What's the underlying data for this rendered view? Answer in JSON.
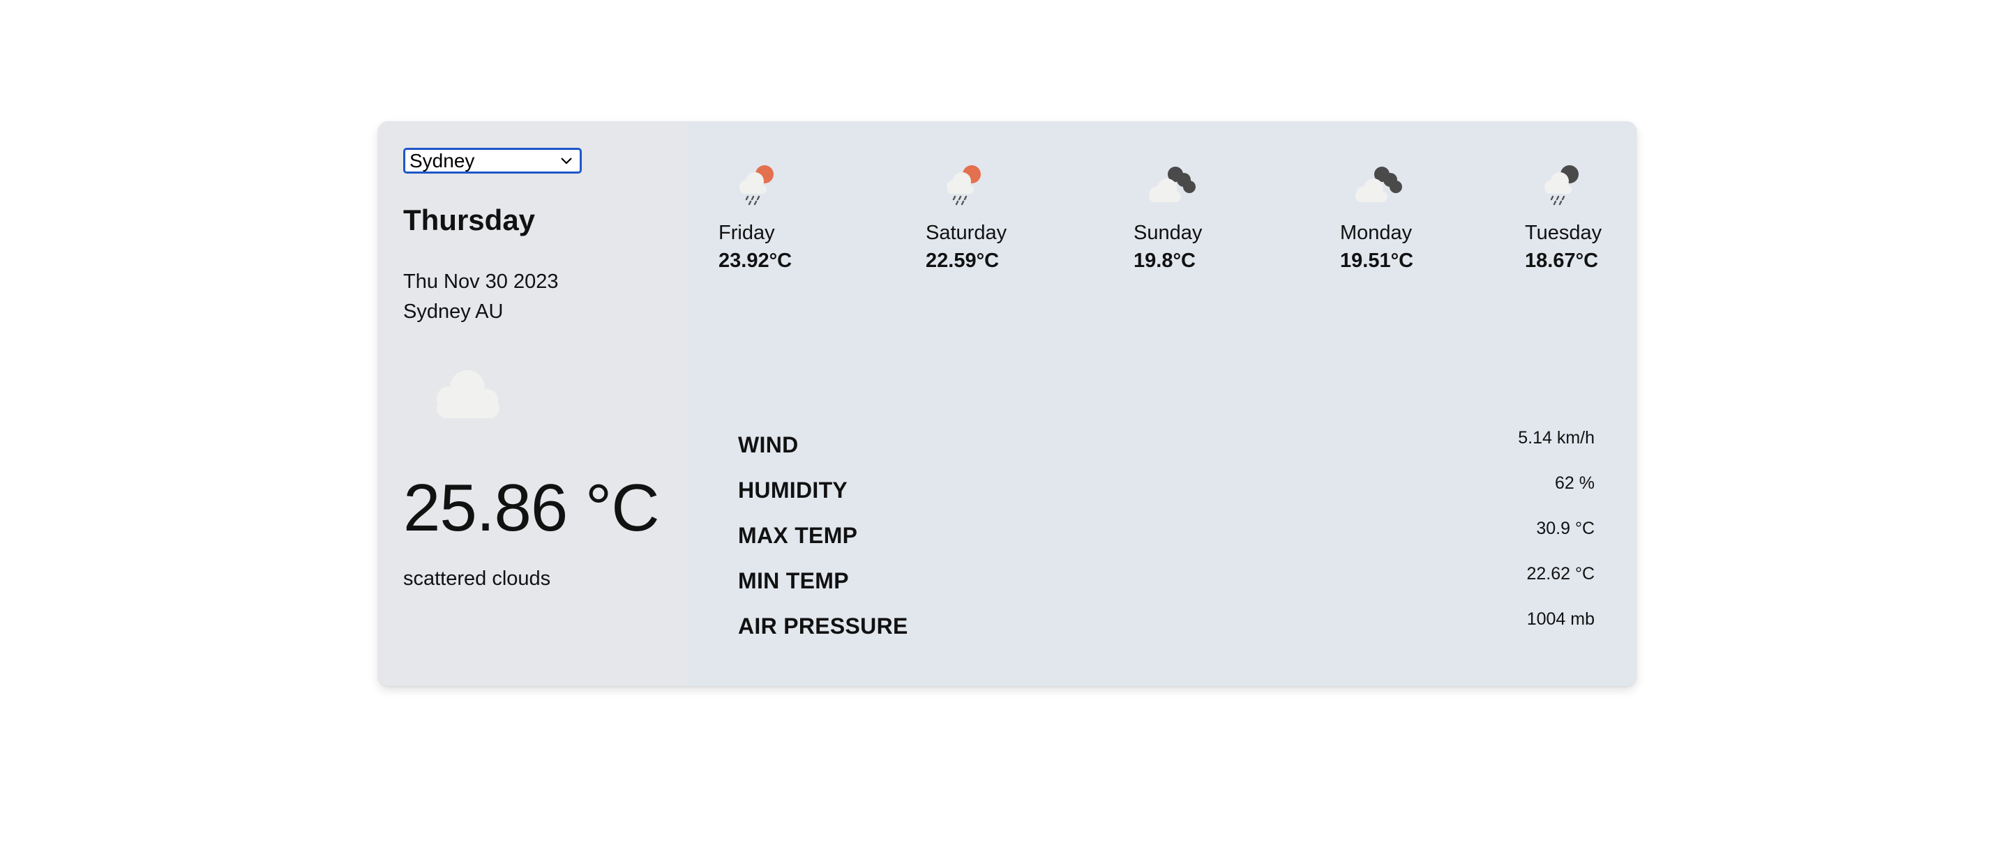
{
  "city_select": {
    "selected": "Sydney"
  },
  "current": {
    "day": "Thursday",
    "date": "Thu Nov 30 2023",
    "location": "Sydney AU",
    "temperature": "25.86 °C",
    "description": "scattered clouds",
    "icon": "cloud-icon"
  },
  "forecast": [
    {
      "day": "Friday",
      "temp": "23.92°C",
      "icon": "light-rain-sun-icon"
    },
    {
      "day": "Saturday",
      "temp": "22.59°C",
      "icon": "light-rain-sun-icon"
    },
    {
      "day": "Sunday",
      "temp": "19.8°C",
      "icon": "broken-clouds-icon"
    },
    {
      "day": "Monday",
      "temp": "19.51°C",
      "icon": "broken-clouds-icon"
    },
    {
      "day": "Tuesday",
      "temp": "18.67°C",
      "icon": "light-rain-dark-cloud-icon"
    }
  ],
  "details": [
    {
      "label": "WIND",
      "value": "5.14 km/h"
    },
    {
      "label": "HUMIDITY",
      "value": "62 %"
    },
    {
      "label": "MAX TEMP",
      "value": "30.9 °C"
    },
    {
      "label": "MIN TEMP",
      "value": "22.62 °C"
    },
    {
      "label": "AIR PRESSURE",
      "value": "1004 mb"
    }
  ],
  "colors": {
    "sun": "#e3714f",
    "dark_cloud": "#4a4a4a",
    "light_cloud": "#f1f1ef",
    "select_border": "#1f57c8"
  }
}
